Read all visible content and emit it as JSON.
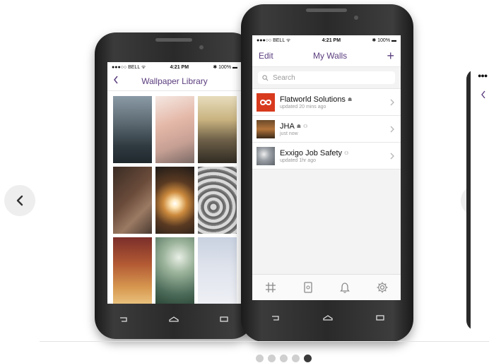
{
  "carousel": {
    "prev_icon": "chevron-left-icon",
    "next_icon": "chevron-right-icon",
    "dots_total": 5,
    "active_dot": 5
  },
  "status_bar": {
    "carrier": "●●●○○ BELL ᯤ",
    "time": "4:21 PM",
    "battery": "✱ 100% ▬"
  },
  "left_phone": {
    "nav_title": "Wallpaper Library",
    "back_icon": "chevron-left-icon",
    "tiles": [
      {
        "name": "city-skyline-tile"
      },
      {
        "name": "keyboard-tile"
      },
      {
        "name": "cityscape-sunset-tile"
      },
      {
        "name": "desk-pens-tile"
      },
      {
        "name": "sparkler-tile"
      },
      {
        "name": "typewriter-keys-tile"
      },
      {
        "name": "warm-gradient-tile"
      },
      {
        "name": "green-bokeh-tile"
      },
      {
        "name": "light-blue-tile"
      }
    ]
  },
  "right_phone": {
    "nav_left": "Edit",
    "nav_title": "My Walls",
    "nav_right": "+",
    "search_placeholder": "Search",
    "walls": [
      {
        "title": "Flatworld Solutions",
        "subtitle": "updated 20 mins ago"
      },
      {
        "title": "JHA",
        "subtitle": "just now"
      },
      {
        "title": "Exxigo Job Safety",
        "subtitle": "updated 1hr ago"
      }
    ],
    "tabs": [
      "hashtag-icon",
      "wall-icon",
      "bell-icon",
      "gear-icon"
    ]
  },
  "colors": {
    "accent_purple": "#5b3d7e",
    "flatworld_red": "#d83a1e"
  }
}
